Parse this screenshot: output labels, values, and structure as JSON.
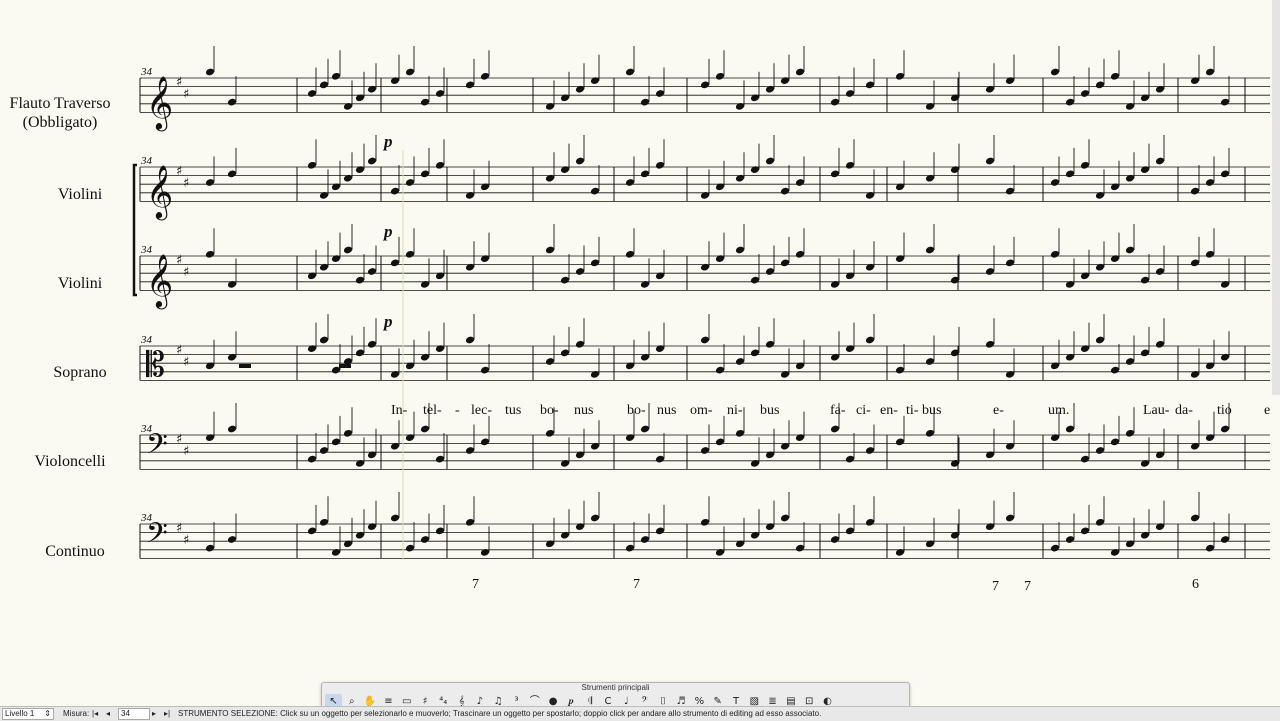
{
  "instruments": [
    {
      "name": "Flauto Traverso",
      "name2": "(Obbligato)"
    },
    {
      "name": "Violini"
    },
    {
      "name": "Violini"
    },
    {
      "name": "Soprano"
    },
    {
      "name": "Violoncelli"
    },
    {
      "name": "Continuo"
    }
  ],
  "measure_number": "34",
  "dynamic_mark": "p",
  "lyrics": [
    "In-",
    "tel-",
    "-",
    "lec-",
    "tus",
    "bo-",
    "nus",
    "bo-",
    "nus",
    "om-",
    "ni-",
    "bus",
    "fa-",
    "ci-",
    "en-",
    "ti-",
    "bus",
    "e-",
    "um.",
    "Lau-",
    "da-",
    "tio",
    "e"
  ],
  "figured_bass": [
    "7",
    "7",
    "7",
    "7",
    "6"
  ],
  "palette": {
    "title": "Strumenti principali",
    "tools": [
      {
        "icon": "selection-arrow-icon",
        "glyph": "↖"
      },
      {
        "icon": "zoom-icon",
        "glyph": "⌕"
      },
      {
        "icon": "hand-grabber-icon",
        "glyph": "✋"
      },
      {
        "icon": "staff-tool-icon",
        "glyph": "≡"
      },
      {
        "icon": "measure-tool-icon",
        "glyph": "▭"
      },
      {
        "icon": "key-signature-icon",
        "glyph": "♯"
      },
      {
        "icon": "time-signature-icon",
        "glyph": "⁴₄"
      },
      {
        "icon": "clef-tool-icon",
        "glyph": "𝄞"
      },
      {
        "icon": "simple-entry-icon",
        "glyph": "♪"
      },
      {
        "icon": "speedy-entry-icon",
        "glyph": "♫"
      },
      {
        "icon": "tuplet-tool-icon",
        "glyph": "³"
      },
      {
        "icon": "smart-shape-icon",
        "glyph": "⌒"
      },
      {
        "icon": "articulation-icon",
        "glyph": "●"
      },
      {
        "icon": "expression-icon",
        "glyph": "𝆏"
      },
      {
        "icon": "repeat-tool-icon",
        "glyph": "𝄇"
      },
      {
        "icon": "chord-tool-icon",
        "glyph": "C"
      },
      {
        "icon": "lyrics-tool-icon",
        "glyph": "♩"
      },
      {
        "icon": "percussion-icon",
        "glyph": "𝄢"
      },
      {
        "icon": "mirror-tool-icon",
        "glyph": "⌷"
      },
      {
        "icon": "special-tools-icon",
        "glyph": "♬"
      },
      {
        "icon": "resize-percent-icon",
        "glyph": "%"
      },
      {
        "icon": "ossia-icon",
        "glyph": "✎"
      },
      {
        "icon": "text-tool-icon",
        "glyph": "T"
      },
      {
        "icon": "graphics-tool-icon",
        "glyph": "▧"
      },
      {
        "icon": "staff-styles-icon",
        "glyph": "≣"
      },
      {
        "icon": "page-layout-icon",
        "glyph": "▤"
      },
      {
        "icon": "hyperscribe-icon",
        "glyph": "⊡"
      },
      {
        "icon": "mixer-icon",
        "glyph": "◐"
      }
    ]
  },
  "status": {
    "layer_label": "Livello 1",
    "measure_label": "Misura:",
    "measure_value": "34",
    "message": "STRUMENTO SELEZIONE: Click su un oggetto per selezionarlo e muoverlo; Trascinare un oggetto per spostarlo; doppio click per andare allo strumento di editing ad esso associato."
  },
  "colors": {
    "paper": "#fbfaf2",
    "ink": "#111111"
  }
}
